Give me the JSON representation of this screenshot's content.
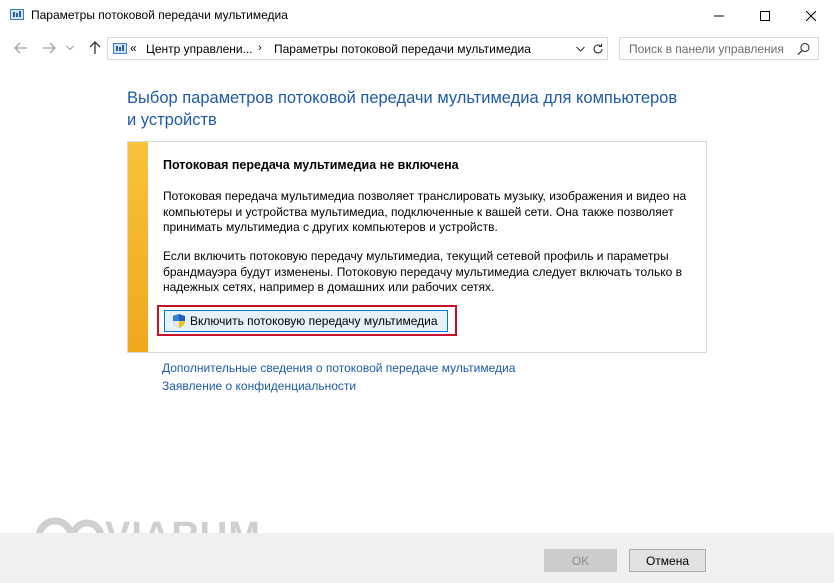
{
  "window": {
    "title": "Параметры потоковой передачи мультимедиа",
    "icon": "control-panel-icon"
  },
  "address_bar": {
    "prefix": "«",
    "crumbs": [
      "Центр управлени...",
      "Параметры потоковой передачи мультимедиа"
    ],
    "separator": "›"
  },
  "search": {
    "placeholder": "Поиск в панели управления"
  },
  "main": {
    "title": "Выбор параметров потоковой передачи мультимедиа для компьютеров и устройств",
    "panel": {
      "accent_color": "#f0a81c",
      "heading": "Потоковая передача мультимедиа не включена",
      "paragraph1": "Потоковая передача мультимедиа позволяет транслировать музыку, изображения и видео на компьютеры и устройства мультимедиа, подключенные к вашей сети. Она также позволяет принимать мультимедиа с других компьютеров и устройств.",
      "paragraph2": "Если включить потоковую передачу мультимедиа, текущий сетевой профиль и параметры брандмауэра будут изменены. Потоковую передачу мультимедиа следует включать только в надежных сетях, например в домашних или рабочих сетях.",
      "enable_button": "Включить потоковую передачу мультимедиа"
    },
    "links": [
      "Дополнительные сведения о потоковой передаче мультимедиа",
      "Заявление о конфиденциальности"
    ]
  },
  "footer": {
    "ok_label": "OK",
    "cancel_label": "Отмена"
  },
  "watermark": {
    "text": "VIARUM"
  },
  "colors": {
    "link": "#1e5aa8",
    "highlight": "#c8102e"
  }
}
